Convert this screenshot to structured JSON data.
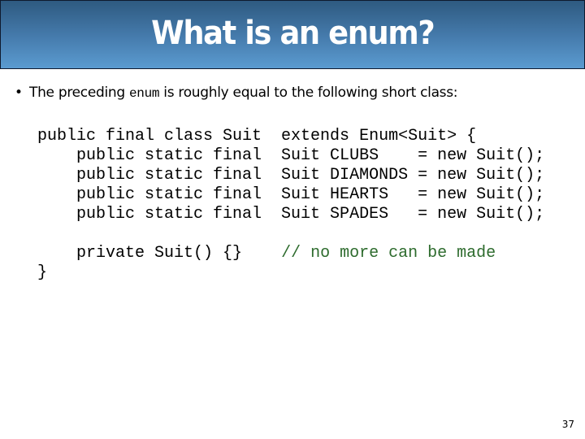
{
  "slide": {
    "title": "What is an enum?",
    "bullet": {
      "symbol": "•",
      "text_before": "The preceding ",
      "inline_code": "enum",
      "text_after": " is roughly equal to the following short class:"
    },
    "code_lines": [
      "public final class Suit  extends Enum<Suit> {",
      "    public static final  Suit CLUBS    = new Suit();",
      "    public static final  Suit DIAMONDS = new Suit();",
      "    public static final  Suit HEARTS   = new Suit();",
      "    public static final  Suit SPADES   = new Suit();",
      "",
      "    private Suit() {}    "
    ],
    "code_comment": "// no more can be made",
    "code_closing": "}",
    "page_number": "37"
  },
  "colors": {
    "title_gradient_top": "#2e5a80",
    "title_gradient_bottom": "#5b9bd0",
    "title_text": "#ffffff",
    "comment": "#2d6b2d"
  }
}
